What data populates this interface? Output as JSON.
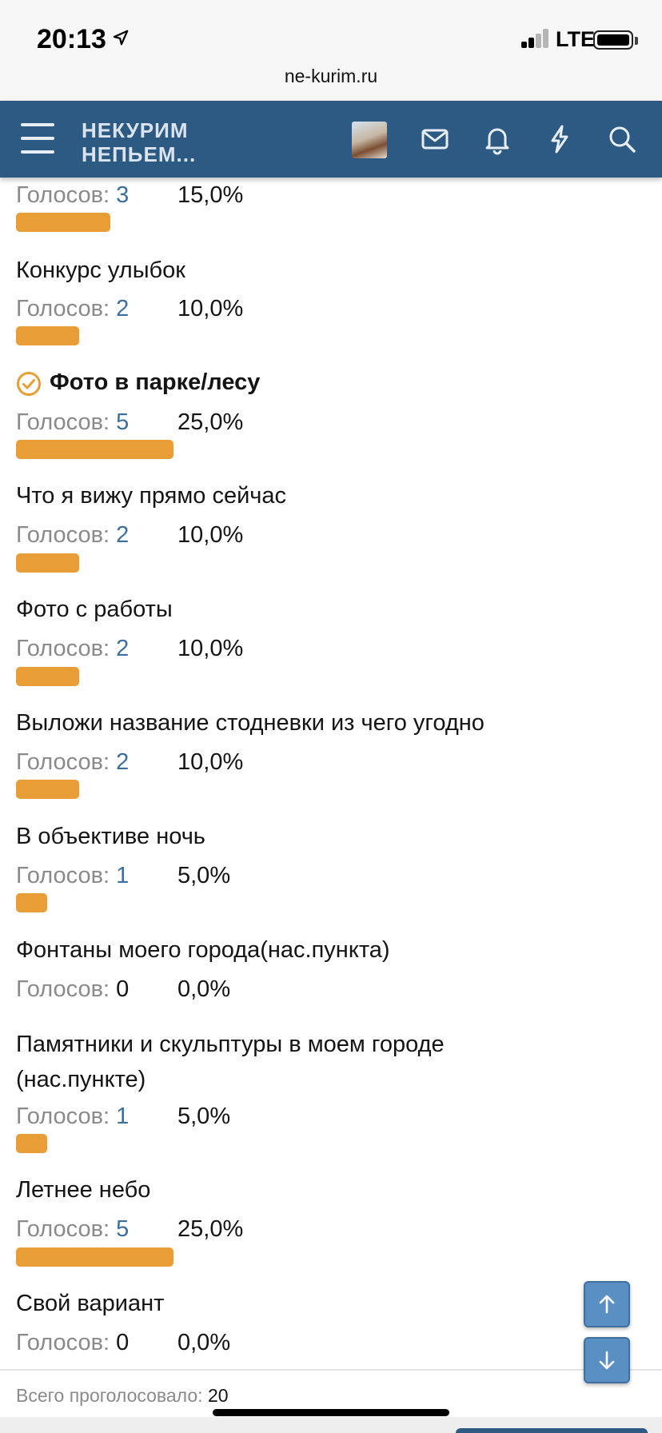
{
  "status_bar": {
    "time": "20:13",
    "network": "LTE"
  },
  "browser": {
    "url": "ne-kurim.ru"
  },
  "header": {
    "logo_line1": "НЕКУРИМ",
    "logo_line2": "НЕПЬЕМ..."
  },
  "poll": {
    "votes_label": "Голосов: ",
    "options": [
      {
        "title": "",
        "votes": "3",
        "percent": "15,0%",
        "fraction": 0.15
      },
      {
        "title": "Конкурс улыбок",
        "votes": "2",
        "percent": "10,0%",
        "fraction": 0.1
      },
      {
        "title": "Фото в парке/лесу",
        "votes": "5",
        "percent": "25,0%",
        "fraction": 0.25,
        "selected": true
      },
      {
        "title": "Что я вижу прямо сейчас",
        "votes": "2",
        "percent": "10,0%",
        "fraction": 0.1
      },
      {
        "title": "Фото с работы",
        "votes": "2",
        "percent": "10,0%",
        "fraction": 0.1
      },
      {
        "title": "Выложи название стодневки из чего угодно",
        "votes": "2",
        "percent": "10,0%",
        "fraction": 0.1
      },
      {
        "title": "В объективе ночь",
        "votes": "1",
        "percent": "5,0%",
        "fraction": 0.05
      },
      {
        "title": "Фонтаны моего города(нас.пункта)",
        "votes": "0",
        "percent": "0,0%",
        "fraction": 0
      },
      {
        "title": "Памятники и скульптуры в моем городе (нас.пункте)",
        "votes": "1",
        "percent": "5,0%",
        "fraction": 0.05
      },
      {
        "title": "Летнее небо",
        "votes": "5",
        "percent": "25,0%",
        "fraction": 0.25
      },
      {
        "title": "Свой вариант",
        "votes": "0",
        "percent": "0,0%",
        "fraction": 0
      }
    ],
    "total_label": "Всего проголосовало: ",
    "total": "20"
  },
  "colors": {
    "header_bg": "#2c5a83",
    "bar": "#e99d36",
    "vote_count": "#3b6fa0",
    "selected_check": "#e99d36"
  },
  "icons": [
    "location-arrow-icon",
    "menu-icon",
    "mail-icon",
    "bell-icon",
    "lightning-icon",
    "search-icon",
    "check-circle-icon",
    "arrow-up-icon",
    "arrow-down-icon"
  ]
}
